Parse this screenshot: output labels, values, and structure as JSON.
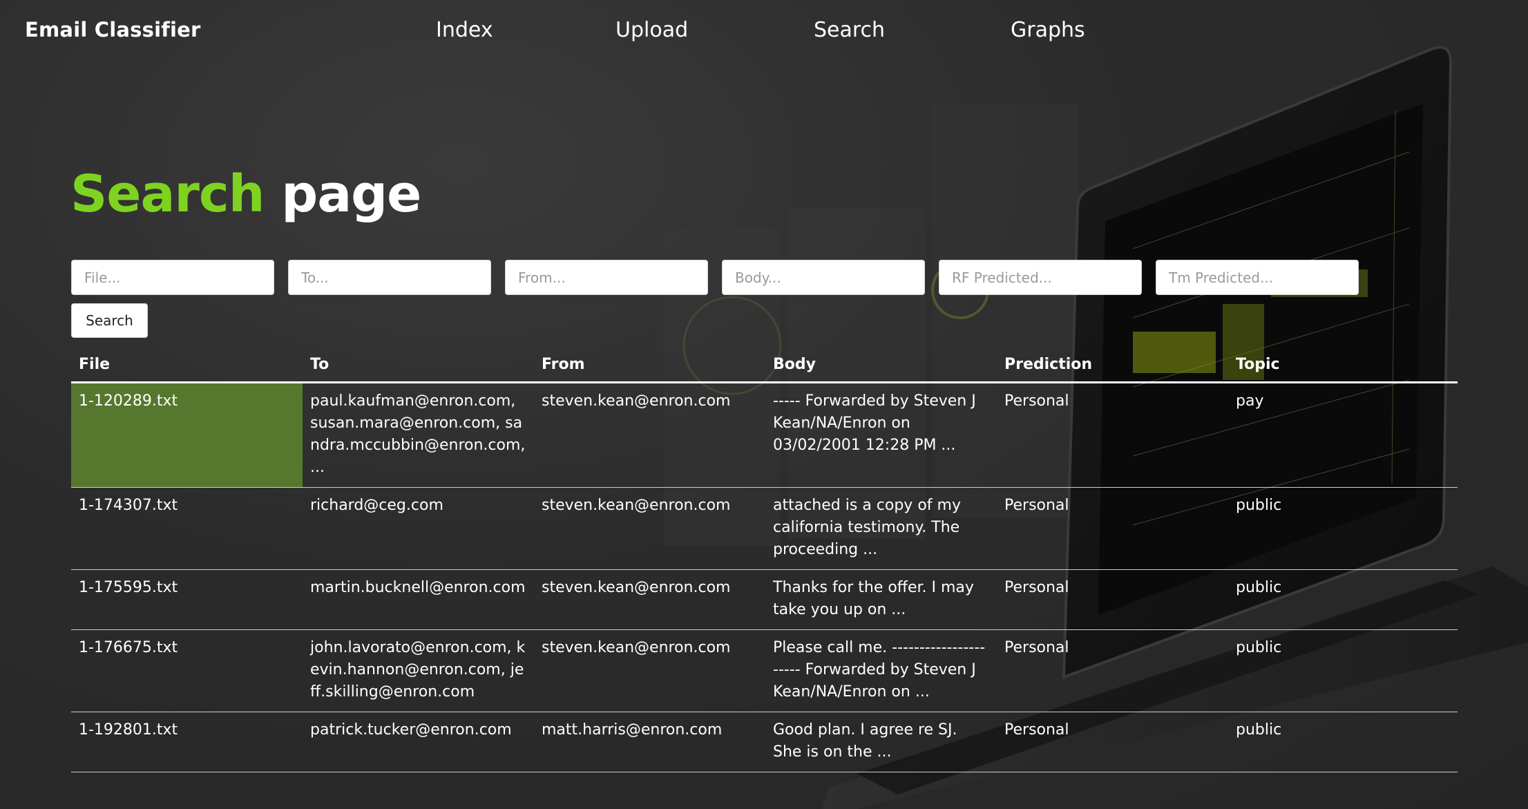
{
  "nav": {
    "brand": "Email Classifier",
    "links": [
      "Index",
      "Upload",
      "Search",
      "Graphs"
    ]
  },
  "heading": {
    "accent": "Search",
    "rest": "page"
  },
  "colors": {
    "accent": "#7ed321",
    "highlight_cell": "#56782e",
    "background": "#2a2a2a"
  },
  "search": {
    "placeholders": [
      "File...",
      "To...",
      "From...",
      "Body...",
      "RF Predicted...",
      "Tm Predicted..."
    ],
    "button_label": "Search"
  },
  "table": {
    "headers": [
      "File",
      "To",
      "From",
      "Body",
      "Prediction",
      "Topic"
    ],
    "rows": [
      {
        "file": "1-120289.txt",
        "to": "paul.kaufman@enron.com, susan.mara@enron.com, sandra.mccubbin@enron.com, ...",
        "from": "steven.kean@enron.com",
        "body": "----- Forwarded by Steven J Kean/NA/Enron on 03/02/2001 12:28 PM ...",
        "prediction": "Personal",
        "topic": "pay"
      },
      {
        "file": "1-174307.txt",
        "to": "richard@ceg.com",
        "from": "steven.kean@enron.com",
        "body": "attached is a copy of my california testimony. The proceeding ...",
        "prediction": "Personal",
        "topic": "public"
      },
      {
        "file": "1-175595.txt",
        "to": "martin.bucknell@enron.com",
        "from": "steven.kean@enron.com",
        "body": "Thanks for the offer. I may take you up on ...",
        "prediction": "Personal",
        "topic": "public"
      },
      {
        "file": "1-176675.txt",
        "to": "john.lavorato@enron.com, kevin.hannon@enron.com, jeff.skilling@enron.com",
        "from": "steven.kean@enron.com",
        "body": "Please call me. ---------------------- Forwarded by Steven J Kean/NA/Enron on ...",
        "prediction": "Personal",
        "topic": "public"
      },
      {
        "file": "1-192801.txt",
        "to": "patrick.tucker@enron.com",
        "from": "matt.harris@enron.com",
        "body": "Good plan. I agree re SJ. She is on the ...",
        "prediction": "Personal",
        "topic": "public"
      }
    ]
  }
}
